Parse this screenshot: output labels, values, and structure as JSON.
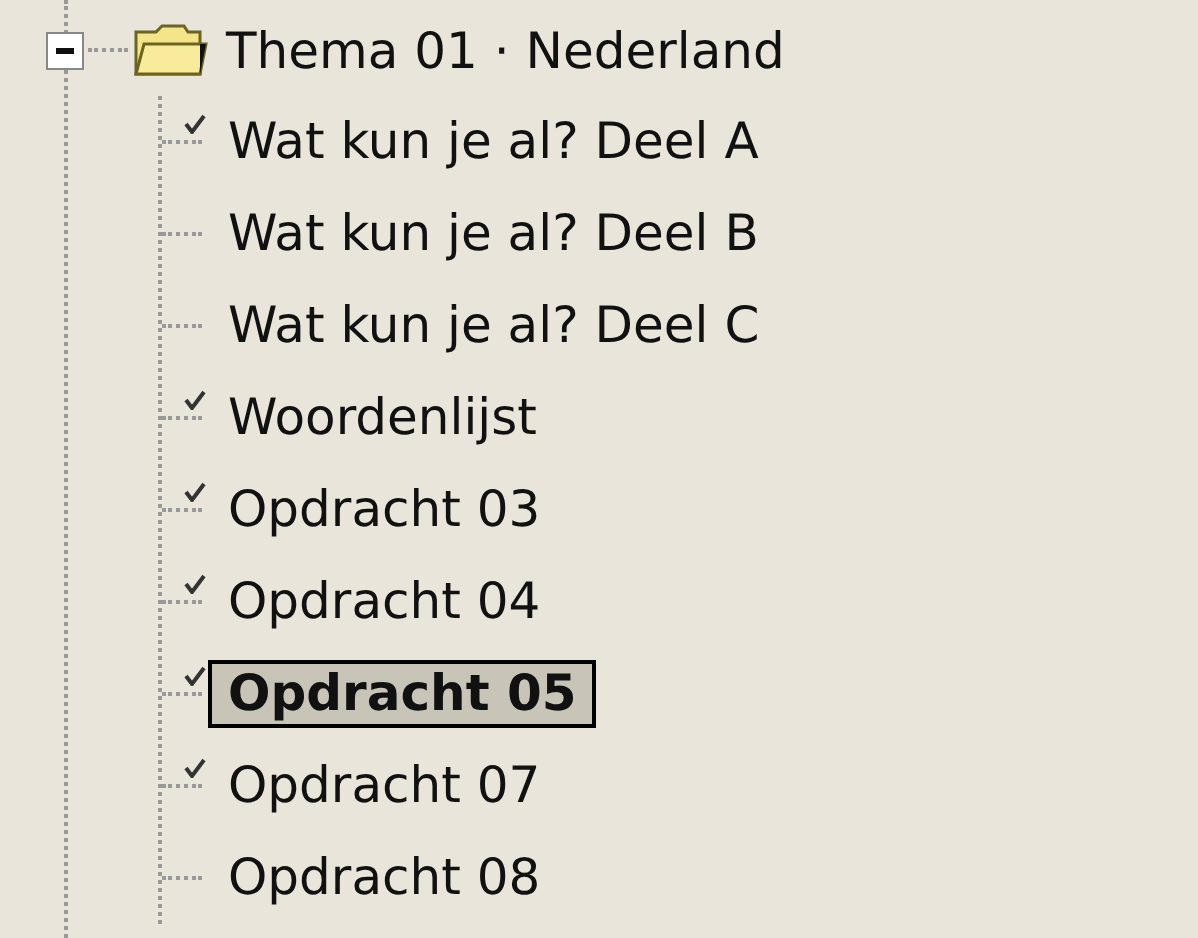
{
  "tree": {
    "label": "Thema 01 · Nederland",
    "expanded": true,
    "children": [
      {
        "label": "Wat kun je al? Deel A",
        "checked": true,
        "selected": false
      },
      {
        "label": "Wat kun je al? Deel B",
        "checked": false,
        "selected": false
      },
      {
        "label": "Wat kun je al? Deel C",
        "checked": false,
        "selected": false
      },
      {
        "label": "Woordenlijst",
        "checked": true,
        "selected": false
      },
      {
        "label": "Opdracht 03",
        "checked": true,
        "selected": false
      },
      {
        "label": "Opdracht 04",
        "checked": true,
        "selected": false
      },
      {
        "label": "Opdracht 05",
        "checked": true,
        "selected": true
      },
      {
        "label": "Opdracht 07",
        "checked": true,
        "selected": false
      },
      {
        "label": "Opdracht 08",
        "checked": false,
        "selected": false
      }
    ]
  }
}
